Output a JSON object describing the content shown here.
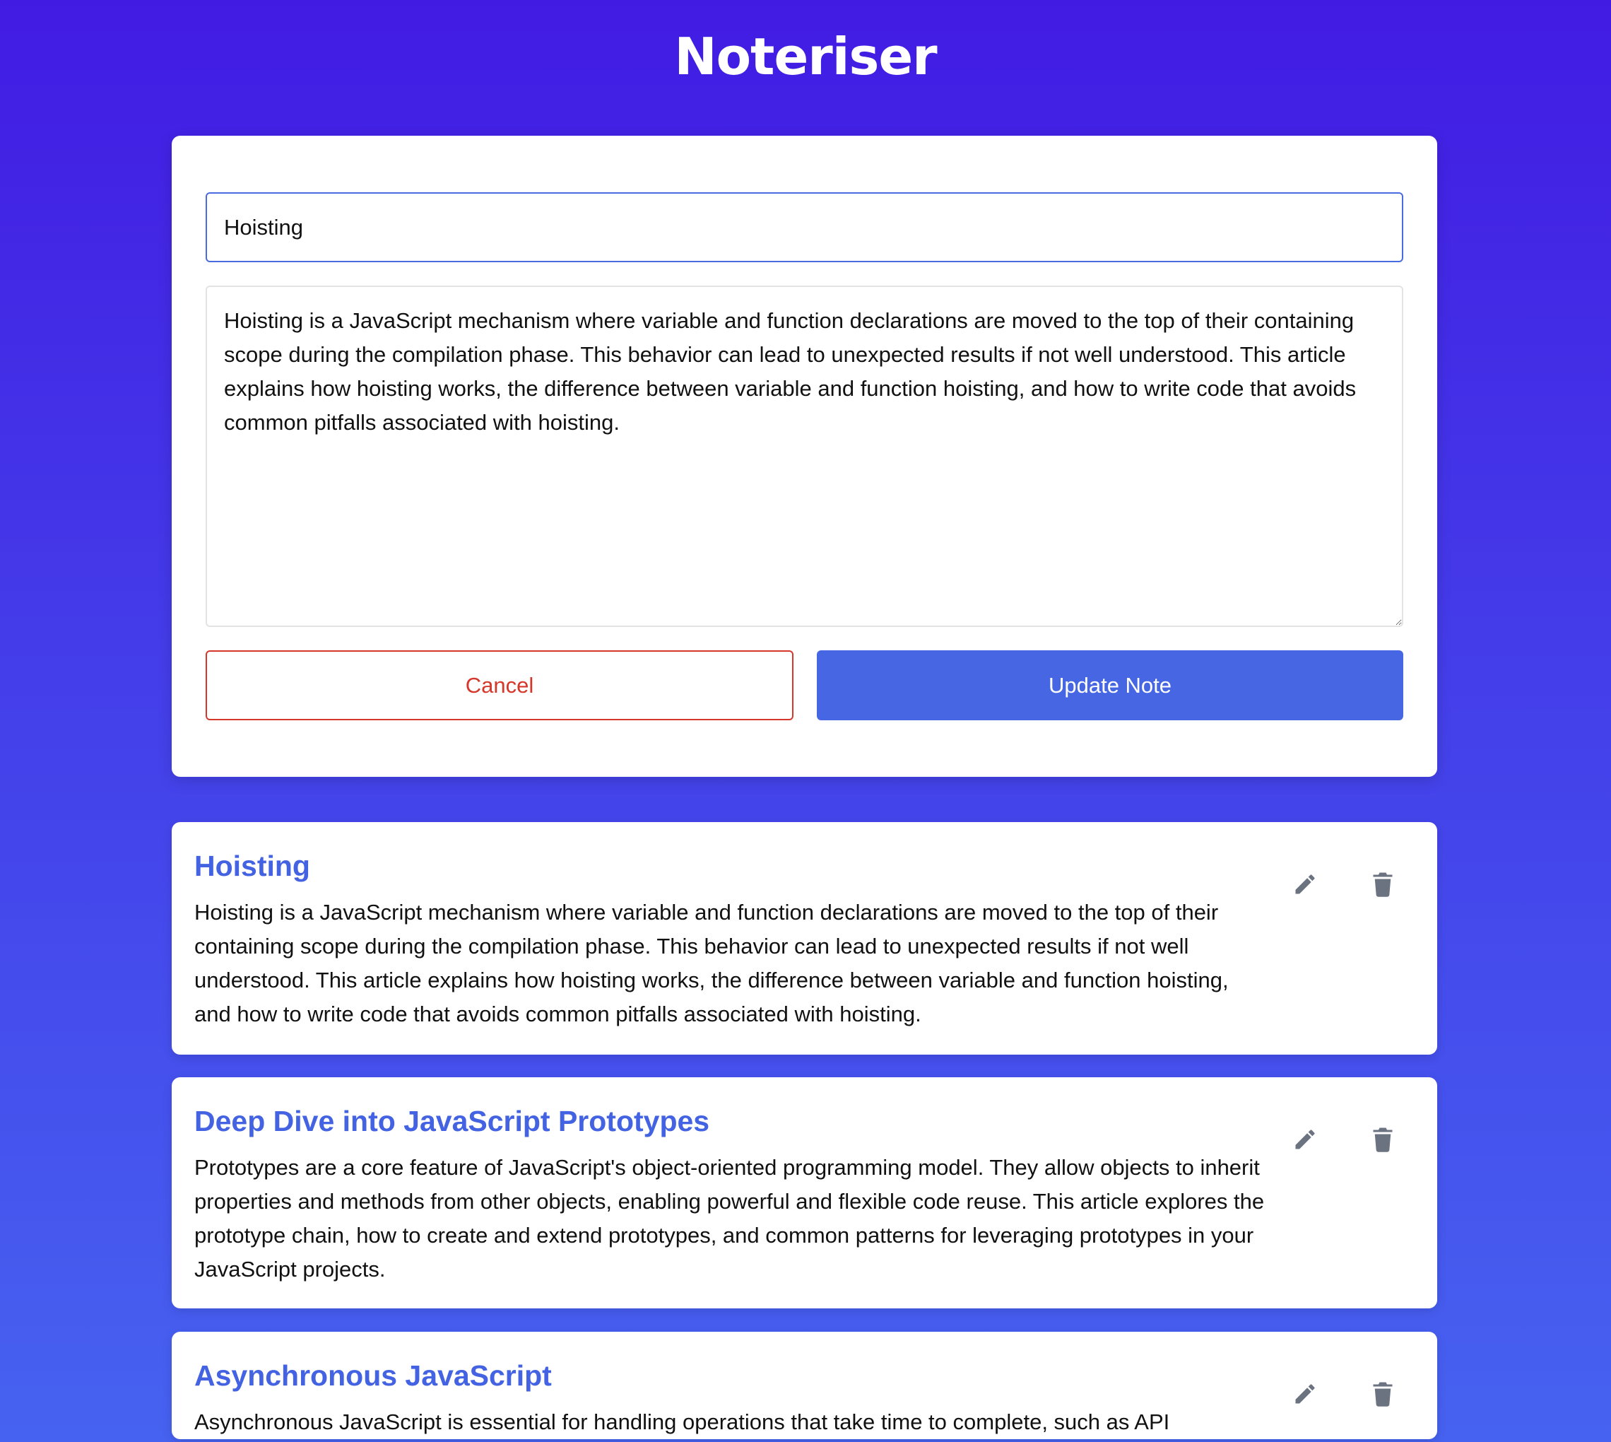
{
  "app": {
    "title": "Noteriser"
  },
  "form": {
    "title_value": "Hoisting",
    "body_value": "Hoisting is a JavaScript mechanism where variable and function declarations are moved to the top of their containing scope during the compilation phase. This behavior can lead to unexpected results if not well understood. This article explains how hoisting works, the difference between variable and function hoisting, and how to write code that avoids common pitfalls associated with hoisting.",
    "cancel_label": "Cancel",
    "submit_label": "Update Note"
  },
  "notes": [
    {
      "title": "Hoisting",
      "body": "Hoisting is a JavaScript mechanism where variable and function declarations are moved to the top of their containing scope during the compilation phase. This behavior can lead to unexpected results if not well understood. This article explains how hoisting works, the difference between variable and function hoisting, and how to write code that avoids common pitfalls associated with hoisting."
    },
    {
      "title": "Deep Dive into JavaScript Prototypes",
      "body": "Prototypes are a core feature of JavaScript's object-oriented programming model. They allow objects to inherit properties and methods from other objects, enabling powerful and flexible code reuse. This article explores the prototype chain, how to create and extend prototypes, and common patterns for leveraging prototypes in your JavaScript projects."
    },
    {
      "title": "Asynchronous JavaScript",
      "body": "Asynchronous JavaScript is essential for handling operations that take time to complete, such as API"
    }
  ],
  "colors": {
    "accent": "#4666e3",
    "danger": "#d6372b",
    "icon": "#6b7280"
  }
}
